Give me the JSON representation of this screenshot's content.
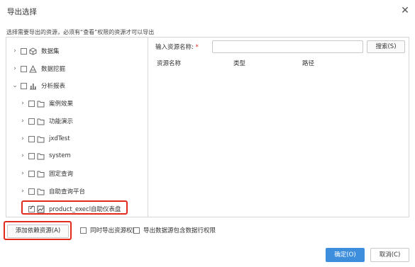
{
  "dialog": {
    "title": "导出选择",
    "close_icon": "close-icon",
    "instruction": "选择需要导出的资源，必须有“查看”权限的资源才可以导出"
  },
  "tree": {
    "nodes": [
      {
        "label": "数据集",
        "expander": "›",
        "icon": "dataset-icon",
        "checked": false
      },
      {
        "label": "数据挖掘",
        "expander": "›",
        "icon": "mining-icon",
        "checked": false
      },
      {
        "label": "分析报表",
        "expander": "⌄",
        "icon": "report-icon",
        "checked": false
      },
      {
        "label": "案例效果",
        "expander": "›",
        "icon": "folder-icon",
        "checked": false
      },
      {
        "label": "功能演示",
        "expander": "›",
        "icon": "folder-icon",
        "checked": false
      },
      {
        "label": "jxdTest",
        "expander": "›",
        "icon": "folder-icon",
        "checked": false
      },
      {
        "label": "system",
        "expander": "›",
        "icon": "folder-icon",
        "checked": false
      },
      {
        "label": "固定查询",
        "expander": "›",
        "icon": "folder-icon",
        "checked": false
      },
      {
        "label": "自助查询平台",
        "expander": "›",
        "icon": "folder-icon",
        "checked": false
      },
      {
        "label": "product_execl自助仪表盘",
        "expander": "",
        "icon": "dashboard-icon",
        "checked": true
      }
    ]
  },
  "search": {
    "label": "输入资源名称:",
    "required_mark": "*",
    "value": "",
    "placeholder": "",
    "button_label": "搜索(S)"
  },
  "results": {
    "columns": [
      "资源名称",
      "类型",
      "路径"
    ]
  },
  "footer": {
    "add_dependency_label": "添加依赖资源(A)",
    "option1_label": "同时导出资源权限",
    "option2_label": "导出数据源包含数据行权限",
    "ok_label": "确定(O)",
    "cancel_label": "取消(C)"
  }
}
